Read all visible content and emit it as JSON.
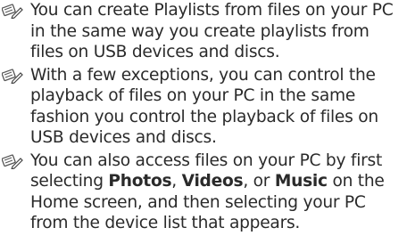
{
  "notes": [
    {
      "icon": "note-pencil-icon",
      "parts": [
        {
          "text": "You can create Playlists from files on your PC in the same way you create playlists from files on USB devices and discs.",
          "bold": false
        }
      ]
    },
    {
      "icon": "note-pencil-icon",
      "parts": [
        {
          "text": "With a few exceptions, you can control the playback of files on your PC in the same fashion you control the playback of files on USB devices and discs.",
          "bold": false
        }
      ]
    },
    {
      "icon": "note-pencil-icon",
      "parts": [
        {
          "text": "You can also access files on your PC by first selecting ",
          "bold": false
        },
        {
          "text": "Photos",
          "bold": true
        },
        {
          "text": ", ",
          "bold": false
        },
        {
          "text": "Videos",
          "bold": true
        },
        {
          "text": ", or ",
          "bold": false
        },
        {
          "text": "Music",
          "bold": true
        },
        {
          "text": " on the Home screen, and then selecting your PC from the device list that appears.",
          "bold": false
        }
      ]
    }
  ]
}
